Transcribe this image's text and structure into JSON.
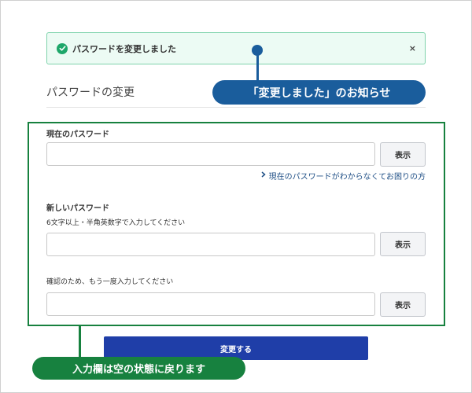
{
  "alert": {
    "message": "パスワードを変更しました",
    "close_label": "×"
  },
  "page": {
    "title": "パスワードの変更"
  },
  "callouts": {
    "notice": "「変更しました」のお知らせ",
    "fields_reset": "入力欄は空の状態に戻ります"
  },
  "form": {
    "current_password": {
      "label": "現在のパスワード",
      "value": "",
      "show_label": "表示"
    },
    "help_link": "現在のパスワードがわからなくてお困りの方",
    "new_password": {
      "label": "新しいパスワード",
      "hint": "6文字以上・半角英数字で入力してください",
      "value": "",
      "show_label": "表示"
    },
    "confirm_password": {
      "hint": "確認のため、もう一度入力してください",
      "value": "",
      "show_label": "表示"
    },
    "submit_label": "変更する"
  },
  "colors": {
    "success_bg": "#ecfbf4",
    "success_border": "#7fd3ac",
    "success_icon": "#1ea76a",
    "callout_blue": "#1a5d9c",
    "callout_green": "#17813f",
    "primary_button": "#1f3ea8",
    "link": "#1f4f86"
  },
  "icons": {
    "alert_icon": "check-circle-icon",
    "link_icon": "chevron-right-icon"
  }
}
